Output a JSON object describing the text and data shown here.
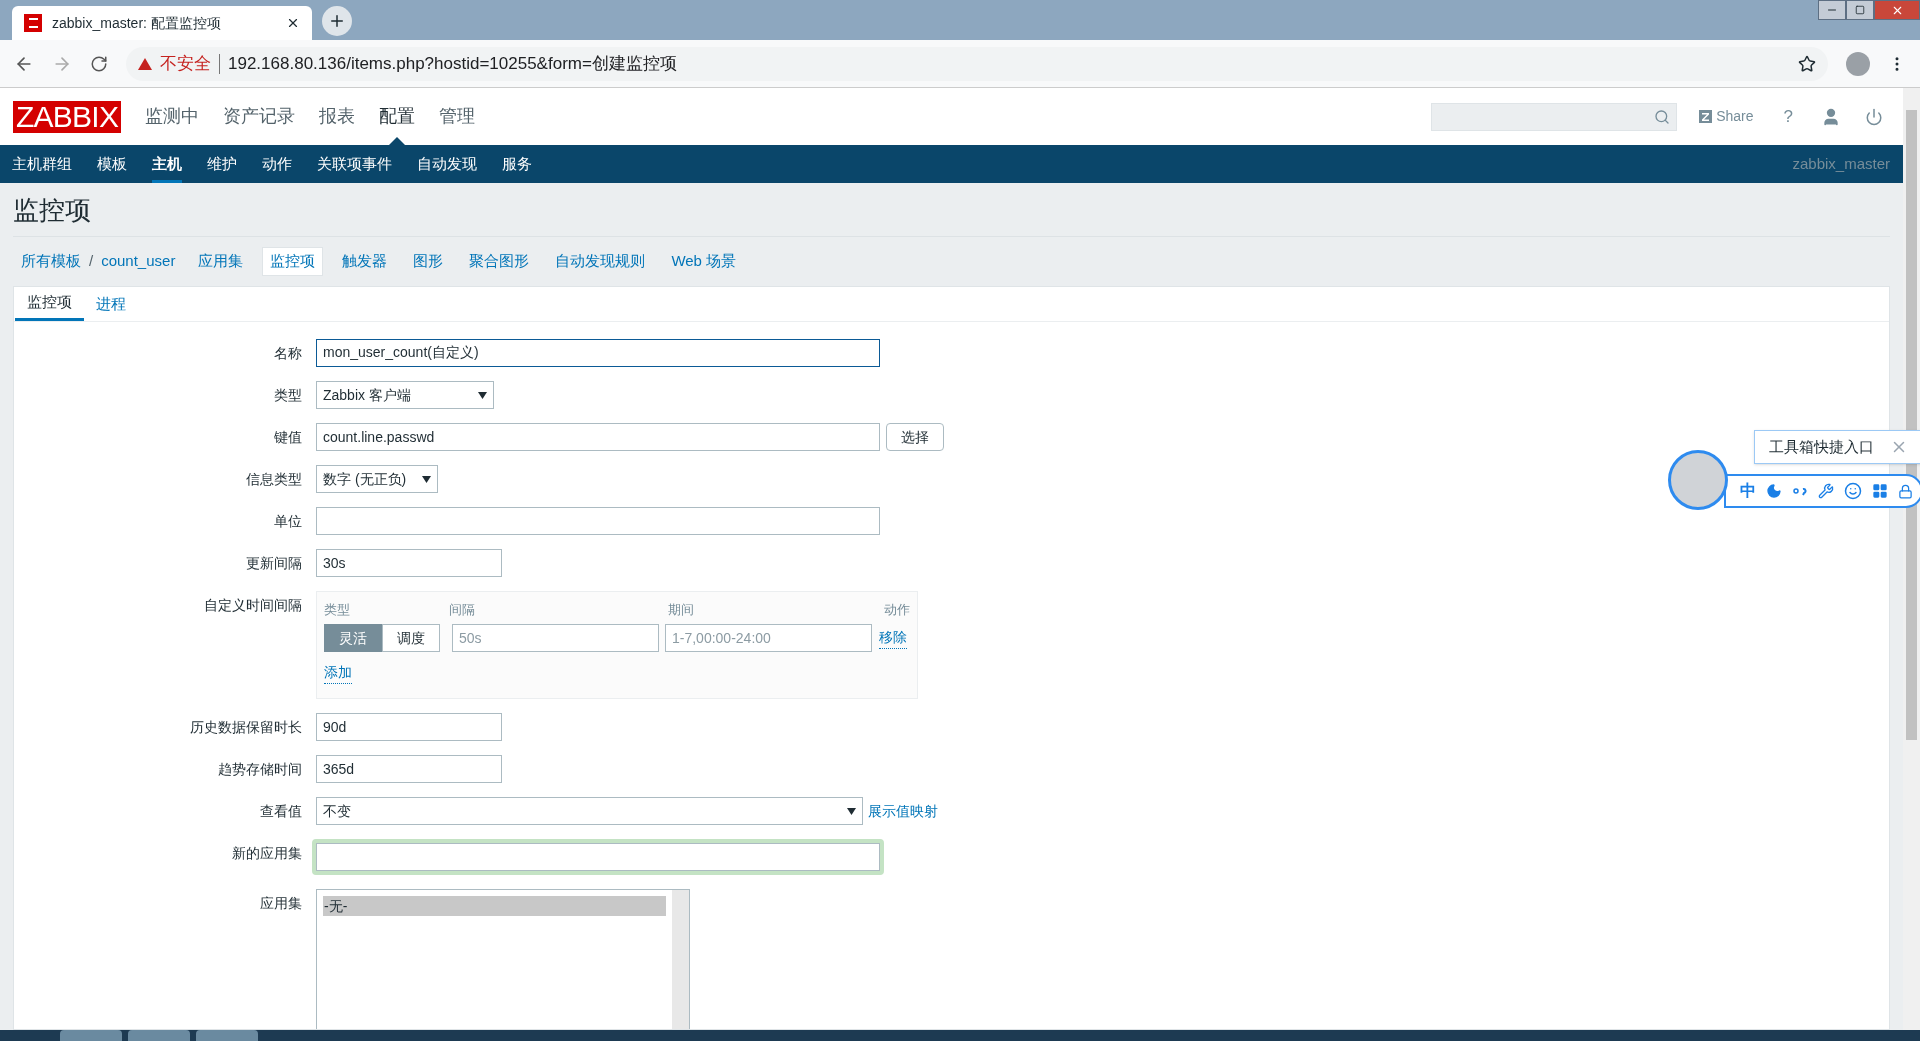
{
  "browser": {
    "tab_title": "zabbix_master: 配置监控项",
    "address": {
      "warning": "不安全",
      "url": "192.168.80.136/items.php?hostid=10255&form=创建监控项"
    }
  },
  "header": {
    "logo": "ZABBIX",
    "menu": [
      {
        "label": "监测中",
        "selected": false
      },
      {
        "label": "资产记录",
        "selected": false
      },
      {
        "label": "报表",
        "selected": false
      },
      {
        "label": "配置",
        "selected": true
      },
      {
        "label": "管理",
        "selected": false
      }
    ],
    "share": "Share",
    "help": "?"
  },
  "subnav": {
    "items": [
      {
        "label": "主机群组",
        "selected": false
      },
      {
        "label": "模板",
        "selected": false
      },
      {
        "label": "主机",
        "selected": true
      },
      {
        "label": "维护",
        "selected": false
      },
      {
        "label": "动作",
        "selected": false
      },
      {
        "label": "关联项事件",
        "selected": false
      },
      {
        "label": "自动发现",
        "selected": false
      },
      {
        "label": "服务",
        "selected": false
      }
    ],
    "user": "zabbix_master"
  },
  "page_title": "监控项",
  "breadcrumb": {
    "path": [
      "所有模板",
      "count_user"
    ],
    "separator": "/",
    "links": [
      {
        "label": "应用集",
        "selected": false
      },
      {
        "label": "监控项",
        "selected": true
      },
      {
        "label": "触发器",
        "selected": false
      },
      {
        "label": "图形",
        "selected": false
      },
      {
        "label": "聚合图形",
        "selected": false
      },
      {
        "label": "自动发现规则",
        "selected": false
      },
      {
        "label": "Web 场景",
        "selected": false
      }
    ]
  },
  "tabs": [
    {
      "label": "监控项",
      "selected": true
    },
    {
      "label": "进程",
      "selected": false
    }
  ],
  "form": [
    {
      "kind": "text",
      "label": "名称",
      "value": "mon_user_count(自定义)",
      "focused": true
    },
    {
      "kind": "select",
      "label": "类型",
      "value": "Zabbix 客户端"
    },
    {
      "kind": "text_button",
      "label": "键值",
      "value": "count.line.passwd",
      "button": "选择"
    },
    {
      "kind": "select_small",
      "label": "信息类型",
      "value": "数字 (无正负)"
    },
    {
      "kind": "text",
      "label": "单位",
      "focused": false
    },
    {
      "kind": "short_text",
      "label": "更新间隔",
      "value": "30s"
    },
    {
      "kind": "intervals",
      "label": "自定义时间间隔",
      "columns": [
        "类型",
        "间隔",
        "期间",
        "动作"
      ],
      "rows": [
        {
          "modes": [
            {
              "label": "灵活",
              "selected": true
            },
            {
              "label": "调度",
              "selected": false
            }
          ],
          "interval_placeholder": "50s",
          "period_placeholder": "1-7,00:00-24:00",
          "action": "移除"
        }
      ],
      "add": "添加"
    },
    {
      "kind": "short_text",
      "label": "历史数据保留时长",
      "value": "90d"
    },
    {
      "kind": "short_text",
      "label": "趋势存储时间",
      "value": "365d"
    },
    {
      "kind": "select_link",
      "label": "查看值",
      "value": "不变",
      "link": "展示值映射"
    },
    {
      "kind": "highlight_text",
      "label": "新的应用集"
    },
    {
      "kind": "listbox",
      "label": "应用集",
      "options": [
        {
          "label": "-无-",
          "selected": true
        }
      ]
    }
  ],
  "widget": {
    "title": "工具箱快捷入口",
    "toolbar_text": "中"
  }
}
